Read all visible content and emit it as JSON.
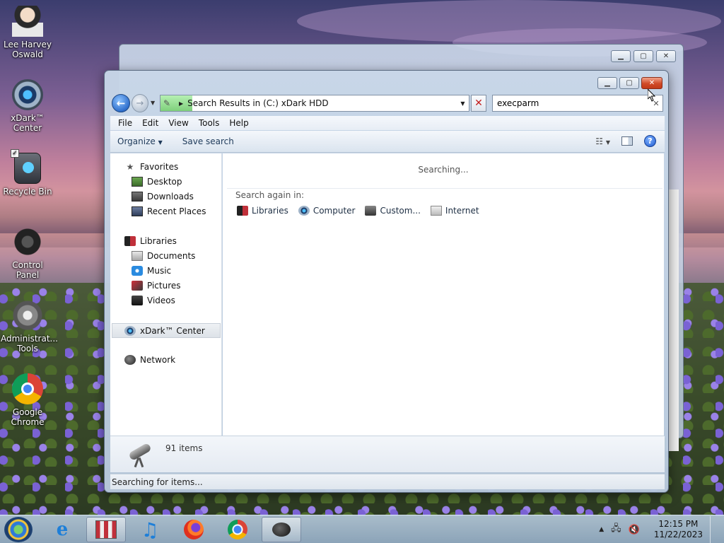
{
  "desktop": {
    "icons": [
      {
        "label": "Lee Harvey\nOswald",
        "icon": "user-anime-icon"
      },
      {
        "label": "xDark™\nCenter",
        "icon": "xdark-center-icon"
      },
      {
        "label": "Recycle Bin",
        "icon": "recycle-bin-icon"
      },
      {
        "label": "Control Panel",
        "icon": "control-panel-icon"
      },
      {
        "label": "Administrat...\nTools",
        "icon": "admin-tools-icon"
      },
      {
        "label": "Google\nChrome",
        "icon": "chrome-icon"
      }
    ]
  },
  "window": {
    "address": {
      "path": "Search Results in (C:) xDark HDD",
      "back_label": "←",
      "forward_label": "→"
    },
    "search": {
      "value": "execparm",
      "placeholder": ""
    },
    "menu": [
      "File",
      "Edit",
      "View",
      "Tools",
      "Help"
    ],
    "toolbar": {
      "organize": "Organize",
      "save_search": "Save search"
    },
    "nav": {
      "favorites": "Favorites",
      "desktop": "Desktop",
      "downloads": "Downloads",
      "recent_places": "Recent Places",
      "libraries": "Libraries",
      "documents": "Documents",
      "music": "Music",
      "pictures": "Pictures",
      "videos": "Videos",
      "xdark_center": "xDark™ Center",
      "network": "Network"
    },
    "content": {
      "status": "Searching...",
      "search_again_label": "Search again in:",
      "search_again": [
        "Libraries",
        "Computer",
        "Custom...",
        "Internet"
      ]
    },
    "details": {
      "count": "91 items"
    },
    "statusbar": "Searching for items..."
  },
  "taskbar": {
    "apps": [
      "explorer",
      "internet-explorer",
      "library",
      "music",
      "firefox",
      "chrome",
      "search"
    ],
    "clock": {
      "time": "12:15 PM",
      "date": "11/22/2023"
    }
  },
  "colors": {
    "accent": "#2f6fcc",
    "close": "#d04a28",
    "progress": "#7fd07c"
  }
}
